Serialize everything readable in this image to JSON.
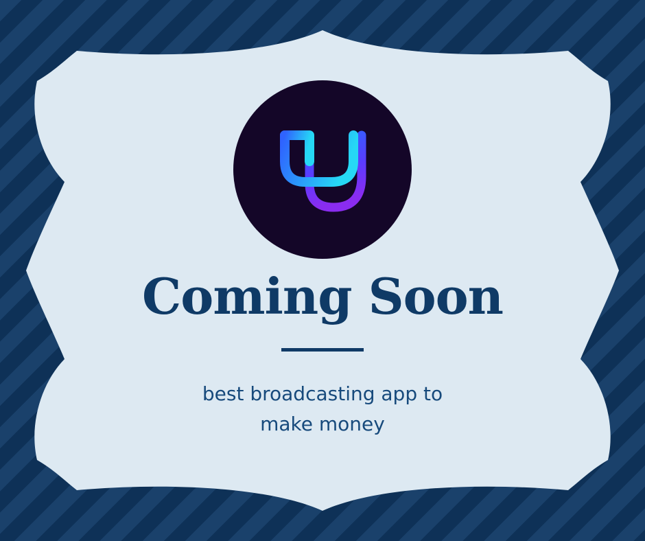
{
  "headline": "Coming Soon",
  "tagline": {
    "line1": "best broadcasting app to",
    "line2": "make money"
  },
  "logo": {
    "letter": "U",
    "icon": "u-letter-logo-icon"
  },
  "colors": {
    "stripe_light": "#1a416b",
    "stripe_dark": "#0e3157",
    "frame_fill": "#dde9f2",
    "text_primary": "#0f3a66",
    "logo_background": "#140628",
    "logo_gradient_start": "#2f63ff",
    "logo_gradient_mid": "#26d8f5",
    "logo_gradient_end": "#8a2cf0"
  }
}
